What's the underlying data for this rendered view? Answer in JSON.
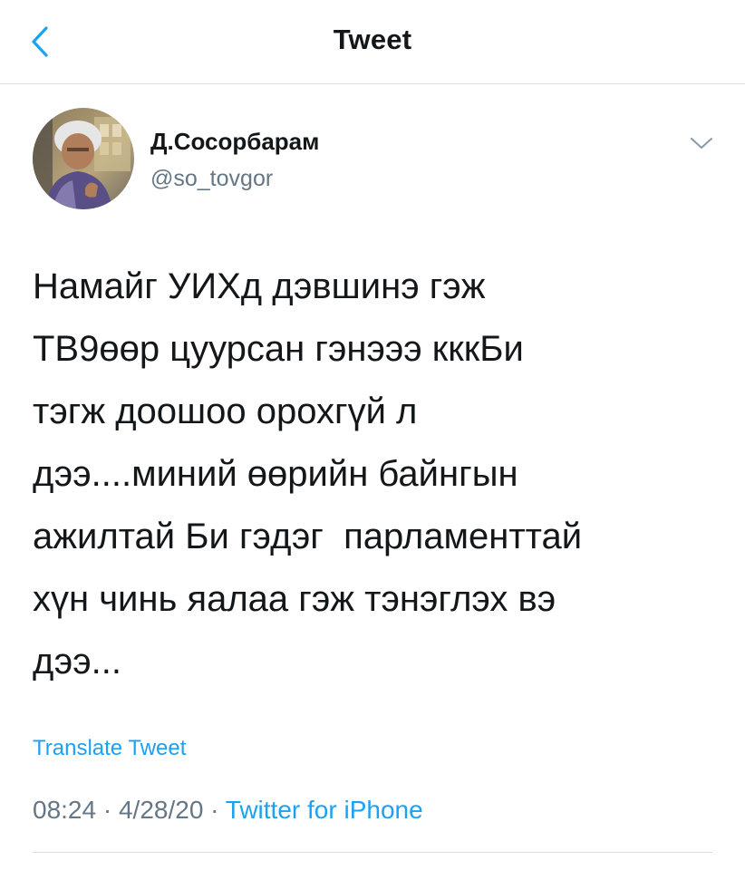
{
  "nav": {
    "title": "Tweet",
    "back_icon": "chevron-left-icon"
  },
  "author": {
    "display_name": "Д.Сосорбарам",
    "handle": "@so_tovgor"
  },
  "tweet": {
    "text": "Намайг УИХд дэвшинэ гэж\nТВ9өөр цуурсан гэнэээ кккБи\nтэгж доошоо орохгүй л\nдээ....миний өөрийн байнгын\nажилтай Би гэдэг  парламенттай\nхүн чинь яалаа гэж тэнэглэх вэ\nдээ...",
    "translate_label": "Translate Tweet",
    "time": "08:24",
    "separator": " · ",
    "date": "4/28/20",
    "source": "Twitter for iPhone"
  },
  "colors": {
    "accent": "#1da1f2",
    "secondary_text": "#657786",
    "primary_text": "#14171a",
    "divider": "#d9dde0"
  }
}
